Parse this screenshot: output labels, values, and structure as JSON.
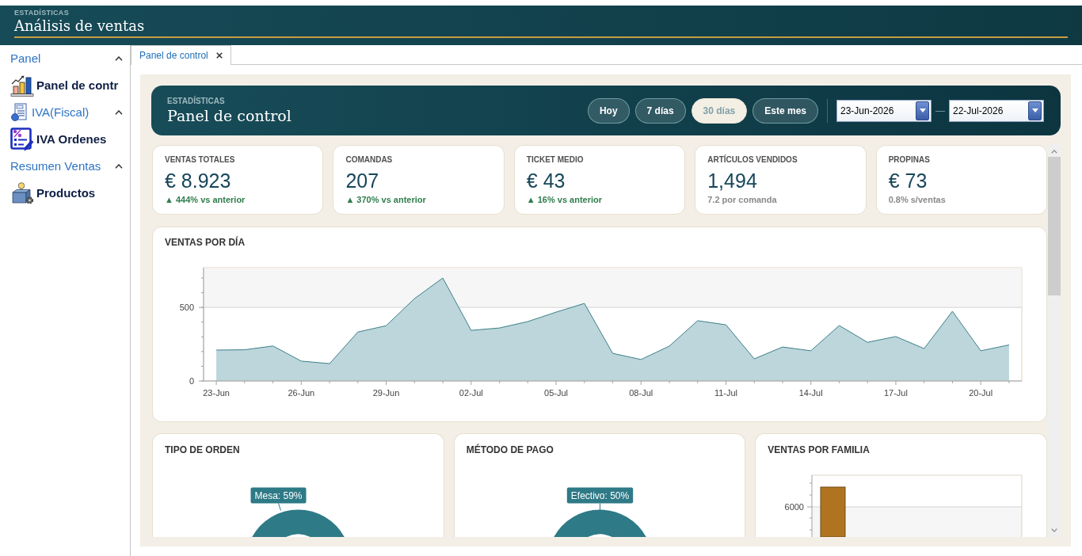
{
  "app": {
    "kicker": "ESTADÍSTICAS",
    "title": "Análisis de ventas"
  },
  "sidebar": {
    "groups": [
      {
        "label": "Panel",
        "expanded": true,
        "items": [
          {
            "label": "Panel de contr"
          }
        ]
      },
      {
        "label": "IVA(Fiscal)",
        "expanded": true,
        "items": [
          {
            "label": "IVA Ordenes"
          }
        ]
      },
      {
        "label": "Resumen Ventas",
        "expanded": true,
        "items": [
          {
            "label": "Productos"
          }
        ]
      }
    ]
  },
  "tabs": [
    {
      "label": "Panel de control",
      "selected": true
    }
  ],
  "dashboard": {
    "kicker": "ESTADÍSTICAS",
    "title": "Panel de control",
    "ranges": [
      {
        "label": "Hoy",
        "selected": false
      },
      {
        "label": "7 días",
        "selected": false
      },
      {
        "label": "30 días",
        "selected": true
      },
      {
        "label": "Este mes",
        "selected": false
      }
    ],
    "date_from": "23-Jun-2026",
    "date_separator": "—",
    "date_to": "22-Jul-2026"
  },
  "kpis": [
    {
      "title": "VENTAS TOTALES",
      "value": "€ 8.923",
      "note": "▲ 444% vs anterior",
      "positive": true
    },
    {
      "title": "COMANDAS",
      "value": "207",
      "note": "▲ 370% vs anterior",
      "positive": true
    },
    {
      "title": "TICKET MEDIO",
      "value": "€ 43",
      "note": "▲ 16% vs anterior",
      "positive": true
    },
    {
      "title": "ARTÍCULOS VENDIDOS",
      "value": "1,494",
      "note": "7.2 por comanda",
      "positive": false
    },
    {
      "title": "PROPINAS",
      "value": "€ 73",
      "note": "0.8% s/ventas",
      "positive": false
    }
  ],
  "sales_chart": {
    "chart_data": {
      "type": "area",
      "title": "VENTAS POR DÍA",
      "categories": [
        "23-Jun",
        null,
        null,
        "26-Jun",
        null,
        null,
        "29-Jun",
        null,
        null,
        "02-Jul",
        null,
        null,
        "05-Jul",
        null,
        null,
        "08-Jul",
        null,
        null,
        "11-Jul",
        null,
        null,
        "14-Jul",
        null,
        null,
        "17-Jul",
        null,
        null,
        "20-Jul",
        null
      ],
      "values": [
        210,
        212,
        238,
        135,
        118,
        333,
        376,
        560,
        700,
        344,
        360,
        404,
        468,
        527,
        188,
        146,
        237,
        410,
        382,
        150,
        231,
        205,
        377,
        263,
        302,
        220,
        474,
        205,
        245
      ],
      "ylim": [
        0,
        770
      ],
      "yticks": [
        0,
        500
      ],
      "bands": [
        {
          "axis": "y",
          "from": 500,
          "to": 770
        }
      ]
    }
  },
  "panels": [
    {
      "title": "TIPO DE ORDEN",
      "kind": "donut",
      "label": "Mesa: 59%"
    },
    {
      "title": "MÉTODO DE PAGO",
      "kind": "donut",
      "label": "Efectivo: 50%"
    },
    {
      "title": "VENTAS POR FAMILIA",
      "kind": "bar",
      "tick_label": "6000"
    }
  ]
}
